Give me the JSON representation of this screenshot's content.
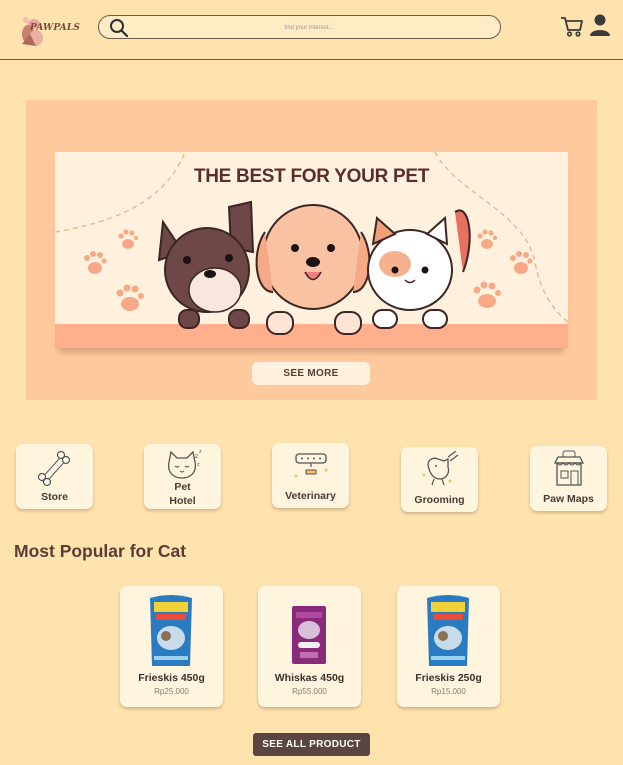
{
  "header": {
    "logo_text": "PAWPALS",
    "search_placeholder": "find your interest..."
  },
  "banner": {
    "title": "THE BEST FOR YOUR PET",
    "button_label": "SEE MORE"
  },
  "categories": [
    {
      "label": "Store",
      "icon": "bone-icon"
    },
    {
      "label_line1": "Pet",
      "label_line2": "Hotel",
      "icon": "sleeping-cat-icon"
    },
    {
      "label": "Veterinary",
      "icon": "pet-collar-icon"
    },
    {
      "label": "Grooming",
      "icon": "grooming-dog-icon"
    },
    {
      "label": "Paw Maps",
      "icon": "pet-shop-icon"
    }
  ],
  "section": {
    "title": "Most Popular for Cat"
  },
  "products": [
    {
      "name": "Frieskis 450g",
      "price": "Rp25.000",
      "color": "#2a7bc0"
    },
    {
      "name": "Whiskas 450g",
      "price": "Rp55.000",
      "color": "#8a2a7a"
    },
    {
      "name": "Frieskis 250g",
      "price": "Rp15.000",
      "color": "#2a7bc0"
    }
  ],
  "see_all_label": "SEE ALL PRODUCT",
  "colors": {
    "background": "#FFE3AE",
    "banner": "#FFC99E",
    "banner_inner": "#FFF1DD",
    "button_dark": "#5a4540"
  }
}
